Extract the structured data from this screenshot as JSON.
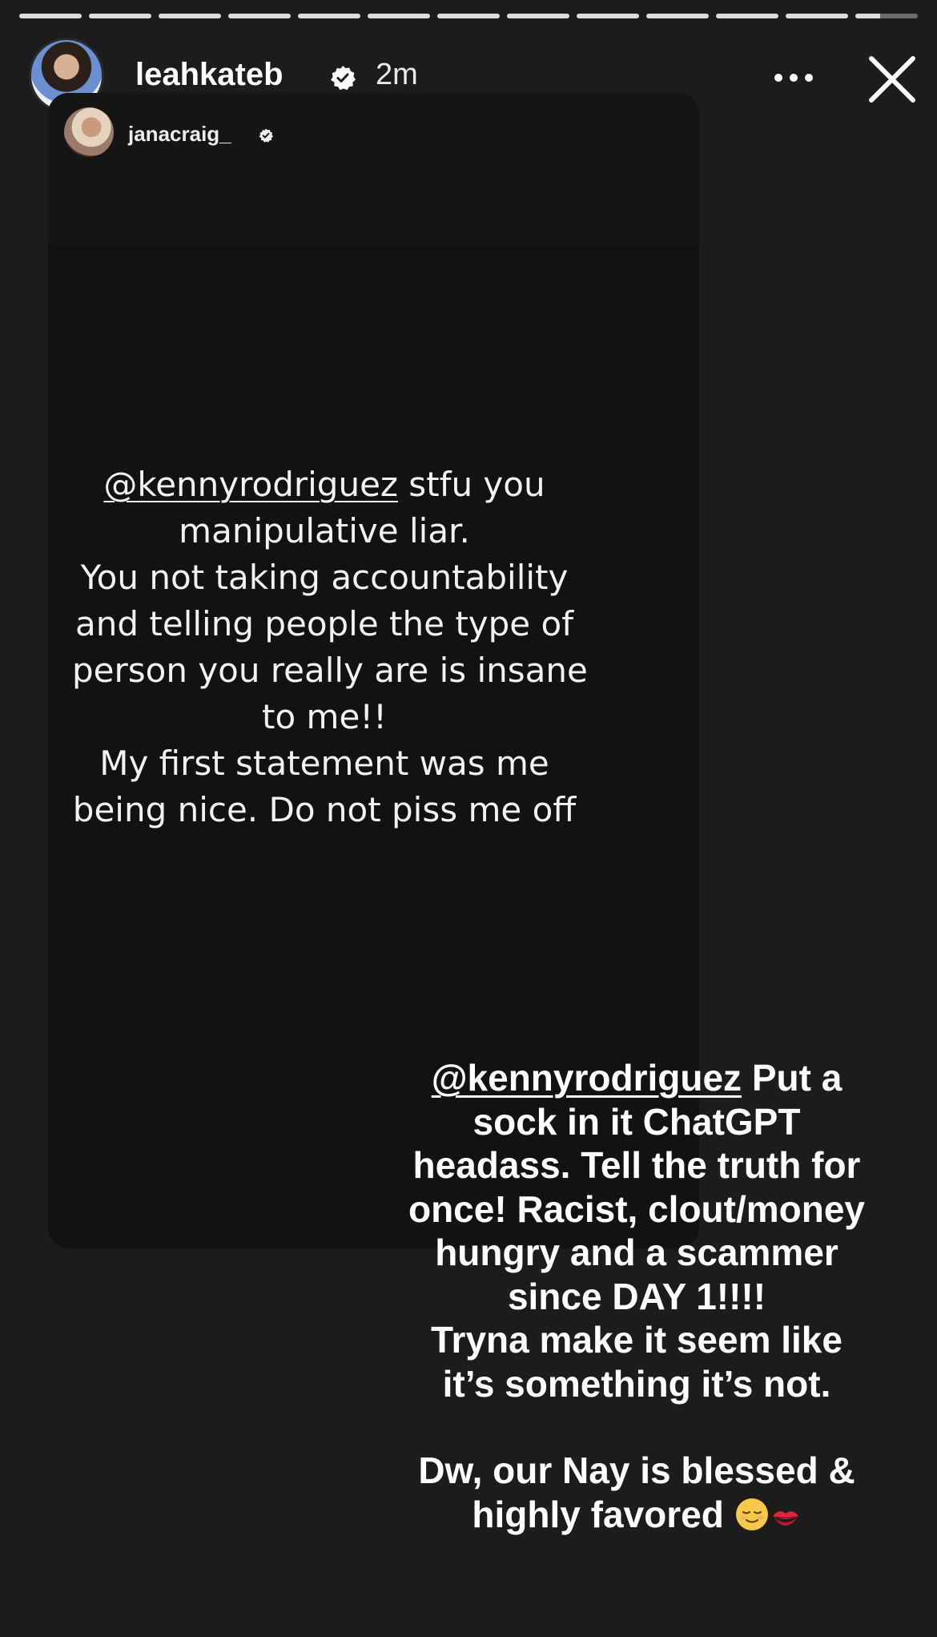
{
  "story": {
    "progress_segments": 13,
    "current_segment": 13,
    "author": {
      "username": "leahkateb",
      "verified": true,
      "time_ago": "2m",
      "avatar_icon": "profile-photo"
    },
    "controls": {
      "more_icon": "more-horizontal-icon",
      "close_icon": "close-icon"
    }
  },
  "shared_post": {
    "author": {
      "username": "janacraig_",
      "verified": true
    },
    "mention": "@kennyrodriguez",
    "lines": [
      " stfu you",
      "manipulative liar.",
      "You not taking accountability",
      "and telling people the type of",
      "person you really are is insane",
      "to me!!",
      "My first statement was me",
      "being nice. Do not piss me off"
    ]
  },
  "overlay": {
    "mention": "@kennyrodriguez",
    "first_line_rest": " Put a",
    "lines": [
      "sock in it ChatGPT",
      "headass. Tell the truth for",
      "once! Racist, clout/money",
      "hungry and a scammer",
      "since DAY 1!!!!",
      "Tryna make it seem like",
      "it’s something it’s not."
    ],
    "closing_lines": [
      "Dw, our Nay is blessed &",
      "highly favored"
    ],
    "emojis": [
      "relieved-face-emoji",
      "kiss-mark-emoji"
    ]
  }
}
